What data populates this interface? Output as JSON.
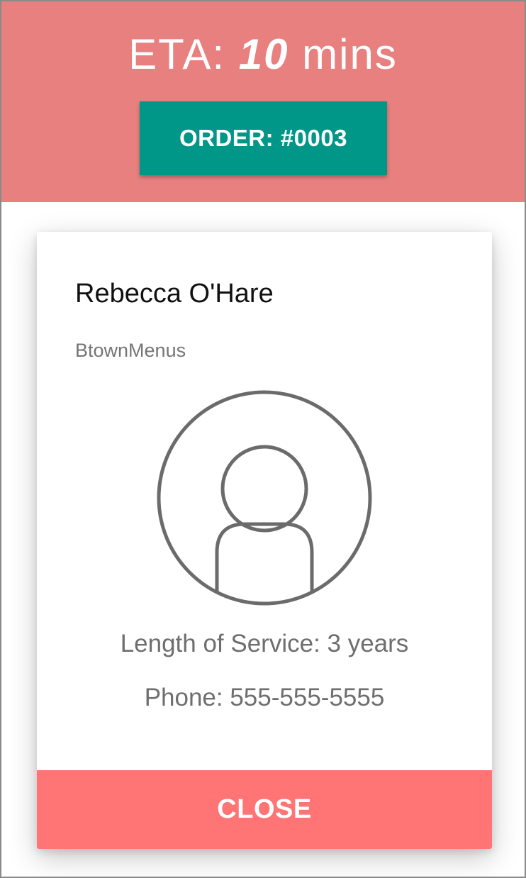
{
  "header": {
    "eta_prefix": "ETA:",
    "eta_value": "10",
    "eta_unit": "mins",
    "order_label": "ORDER: #0003"
  },
  "driver_card": {
    "name": "Rebecca O'Hare",
    "company": "BtownMenus",
    "avatar_icon": "user-avatar-icon",
    "length_of_service": "Length of Service: 3 years",
    "phone": "Phone: 555-555-5555",
    "close_label": "CLOSE"
  },
  "colors": {
    "header_bg": "#e88080",
    "order_button_bg": "#009688",
    "close_button_bg": "#ff7474",
    "avatar_stroke": "#6b6b6b",
    "secondary_text": "#757575"
  }
}
